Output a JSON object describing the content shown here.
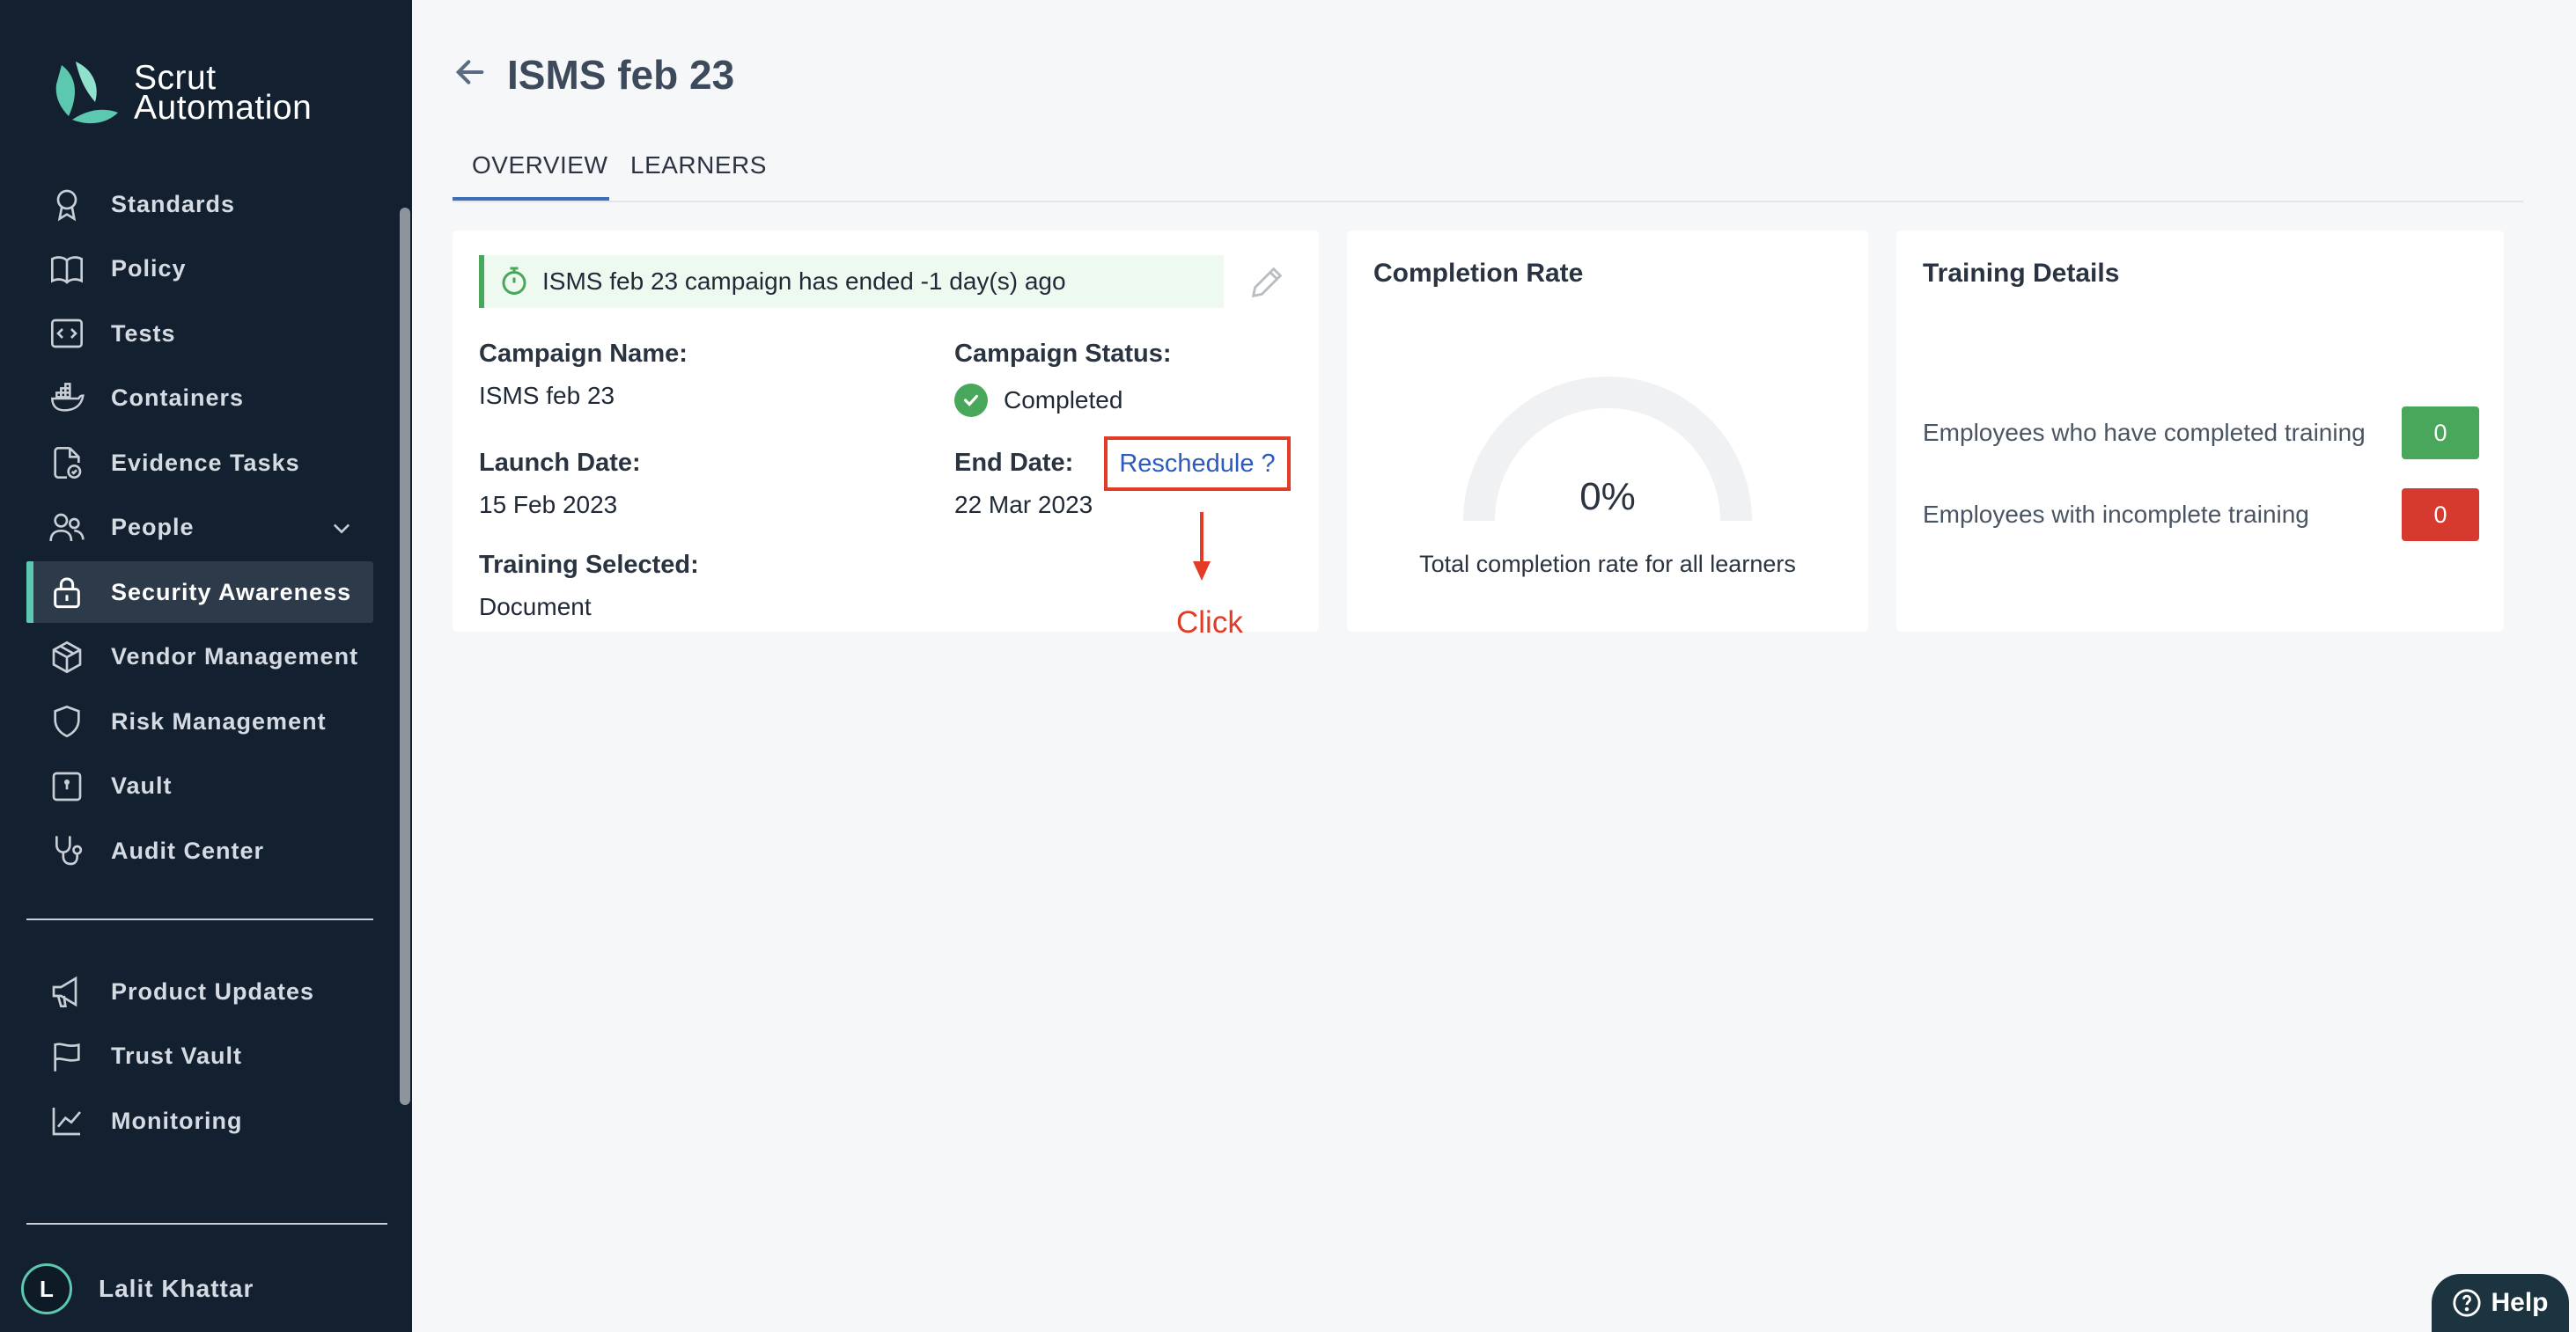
{
  "app": {
    "logo_line1": "Scrut",
    "logo_line2": "Automation",
    "brand_color": "#5cc8b0"
  },
  "sidebar": {
    "items": [
      {
        "label": "Standards",
        "icon": "award-icon"
      },
      {
        "label": "Policy",
        "icon": "book-icon"
      },
      {
        "label": "Tests",
        "icon": "code-icon"
      },
      {
        "label": "Containers",
        "icon": "docker-icon"
      },
      {
        "label": "Evidence Tasks",
        "icon": "file-check-icon"
      },
      {
        "label": "People",
        "icon": "users-icon"
      },
      {
        "label": "Security Awareness",
        "icon": "lock-icon",
        "active": true
      },
      {
        "label": "Vendor Management",
        "icon": "box-icon"
      },
      {
        "label": "Risk Management",
        "icon": "shield-icon"
      },
      {
        "label": "Vault",
        "icon": "vault-icon"
      },
      {
        "label": "Audit Center",
        "icon": "stethoscope-icon"
      }
    ],
    "secondary_items": [
      {
        "label": "Product Updates",
        "icon": "megaphone-icon"
      },
      {
        "label": "Trust Vault",
        "icon": "flag-icon"
      },
      {
        "label": "Monitoring",
        "icon": "chart-line-icon"
      }
    ],
    "user": {
      "initial": "L",
      "name": "Lalit Khattar"
    }
  },
  "page": {
    "title": "ISMS feb 23"
  },
  "tabs": [
    {
      "label": "OVERVIEW",
      "active": true
    },
    {
      "label": "LEARNERS"
    }
  ],
  "campaign": {
    "banner": "ISMS feb 23 campaign has ended -1 day(s) ago",
    "name_label": "Campaign Name:",
    "name_value": "ISMS feb 23",
    "status_label": "Campaign Status:",
    "status_value": "Completed",
    "launch_label": "Launch Date:",
    "launch_value": "15 Feb 2023",
    "end_label": "End Date:",
    "end_value": "22 Mar 2023",
    "reschedule_label": "Reschedule ?",
    "training_label": "Training Selected:",
    "training_value": "Document",
    "annotation": "Click"
  },
  "completion": {
    "title": "Completion Rate",
    "value_text": "0%",
    "value": 0,
    "caption": "Total completion rate for all learners"
  },
  "training": {
    "title": "Training Details",
    "completed_label": "Employees who have completed training",
    "completed_value": "0",
    "incomplete_label": "Employees with incomplete training",
    "incomplete_value": "0"
  },
  "help": {
    "label": "Help"
  }
}
